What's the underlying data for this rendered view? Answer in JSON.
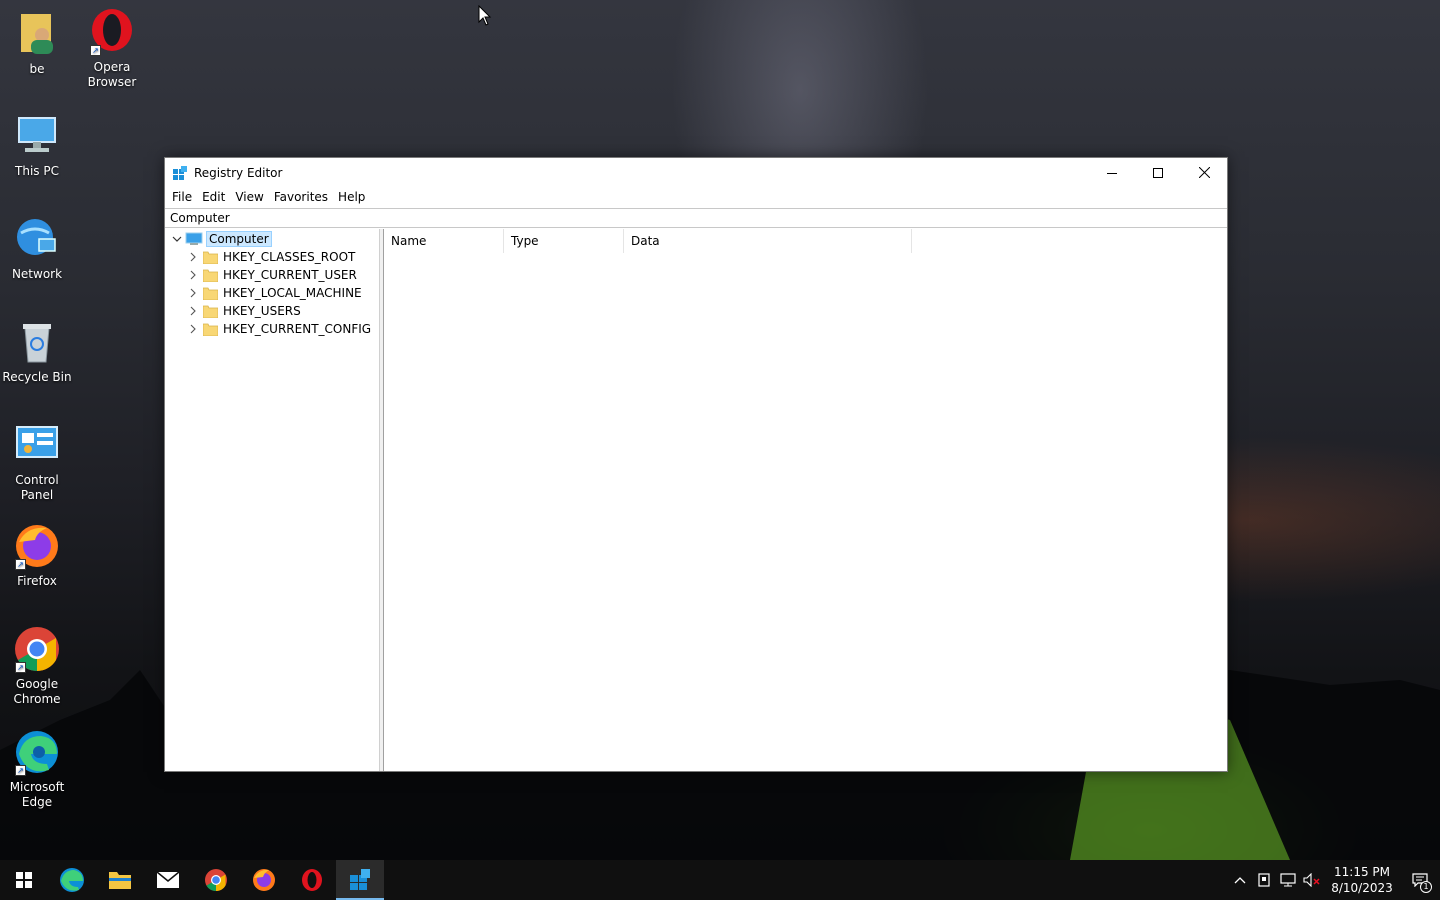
{
  "desktop": {
    "icons": [
      {
        "label": "be"
      },
      {
        "label": "Opera\nBrowser"
      },
      {
        "label": "This PC"
      },
      {
        "label": "Network"
      },
      {
        "label": "Recycle Bin"
      },
      {
        "label": "Control\nPanel"
      },
      {
        "label": "Firefox"
      },
      {
        "label": "Google\nChrome"
      },
      {
        "label": "Microsoft\nEdge"
      }
    ]
  },
  "window": {
    "title": "Registry Editor",
    "menu": [
      "File",
      "Edit",
      "View",
      "Favorites",
      "Help"
    ],
    "address": "Computer",
    "tree": {
      "root": "Computer",
      "children": [
        "HKEY_CLASSES_ROOT",
        "HKEY_CURRENT_USER",
        "HKEY_LOCAL_MACHINE",
        "HKEY_USERS",
        "HKEY_CURRENT_CONFIG"
      ]
    },
    "columns": [
      "Name",
      "Type",
      "Data"
    ]
  },
  "taskbar": {
    "apps": [
      "start",
      "edge",
      "file-explorer",
      "mail",
      "chrome",
      "firefox",
      "opera",
      "registry-editor"
    ],
    "active_app": "registry-editor",
    "clock_time": "11:15 PM",
    "clock_date": "8/10/2023",
    "notification_count": "1"
  },
  "colors": {
    "accent": "#0078d7",
    "selection": "#cce8ff",
    "taskbar": "#101010"
  }
}
